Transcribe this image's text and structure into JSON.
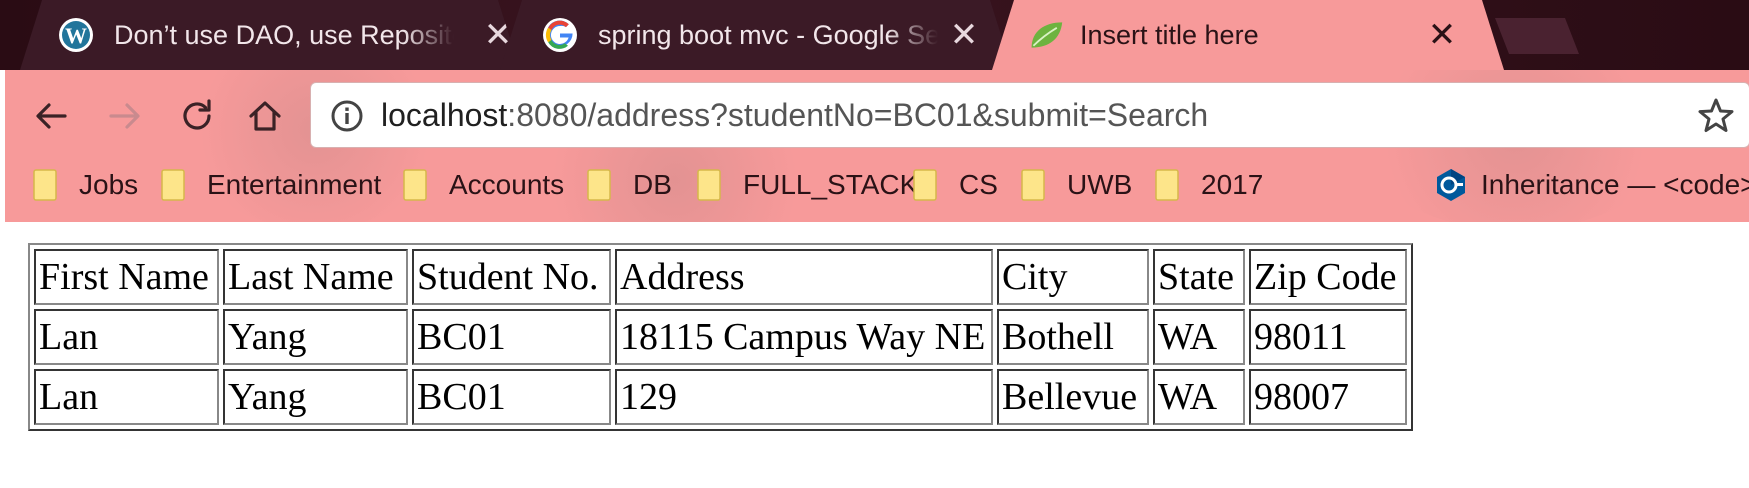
{
  "tabs": [
    {
      "title": "Don’t use DAO, use Repository",
      "icon": "wordpress-icon",
      "close": "✕",
      "active": false
    },
    {
      "title": "spring boot mvc - Google Search",
      "icon": "google-icon",
      "close": "✕",
      "active": false
    },
    {
      "title": "Insert title here",
      "icon": "spring-leaf-icon",
      "close": "✕",
      "active": true
    }
  ],
  "address_bar": {
    "host": "localhost",
    "rest": ":8080/address?studentNo=BC01&submit=Search"
  },
  "bookmarks": [
    {
      "label": "Jobs",
      "icon": "folder-icon"
    },
    {
      "label": "Entertainment",
      "icon": "folder-icon"
    },
    {
      "label": "Accounts",
      "icon": "folder-icon"
    },
    {
      "label": "DB",
      "icon": "folder-icon"
    },
    {
      "label": "FULL_STACK",
      "icon": "folder-icon"
    },
    {
      "label": "CS",
      "icon": "folder-icon"
    },
    {
      "label": "UWB",
      "icon": "folder-icon"
    },
    {
      "label": "2017",
      "icon": "folder-icon"
    },
    {
      "label": "Inheritance — <code>",
      "icon": "cpp-icon"
    }
  ],
  "table": {
    "headers": [
      "First Name",
      "Last Name",
      "Student No.",
      "Address",
      "City",
      "State",
      "Zip Code"
    ],
    "rows": [
      [
        "Lan",
        "Yang",
        "BC01",
        "18115 Campus Way NE",
        "Bothell",
        "WA",
        "98011"
      ],
      [
        "Lan",
        "Yang",
        "BC01",
        "129",
        "Bellevue",
        "WA",
        "98007"
      ]
    ]
  },
  "colors": {
    "tab_active": "#f79a9a",
    "tab_inactive": "#3b1a26",
    "tabstrip": "#2a0c14",
    "toolbar": "#f79a9a",
    "folder": "#fde58a"
  }
}
